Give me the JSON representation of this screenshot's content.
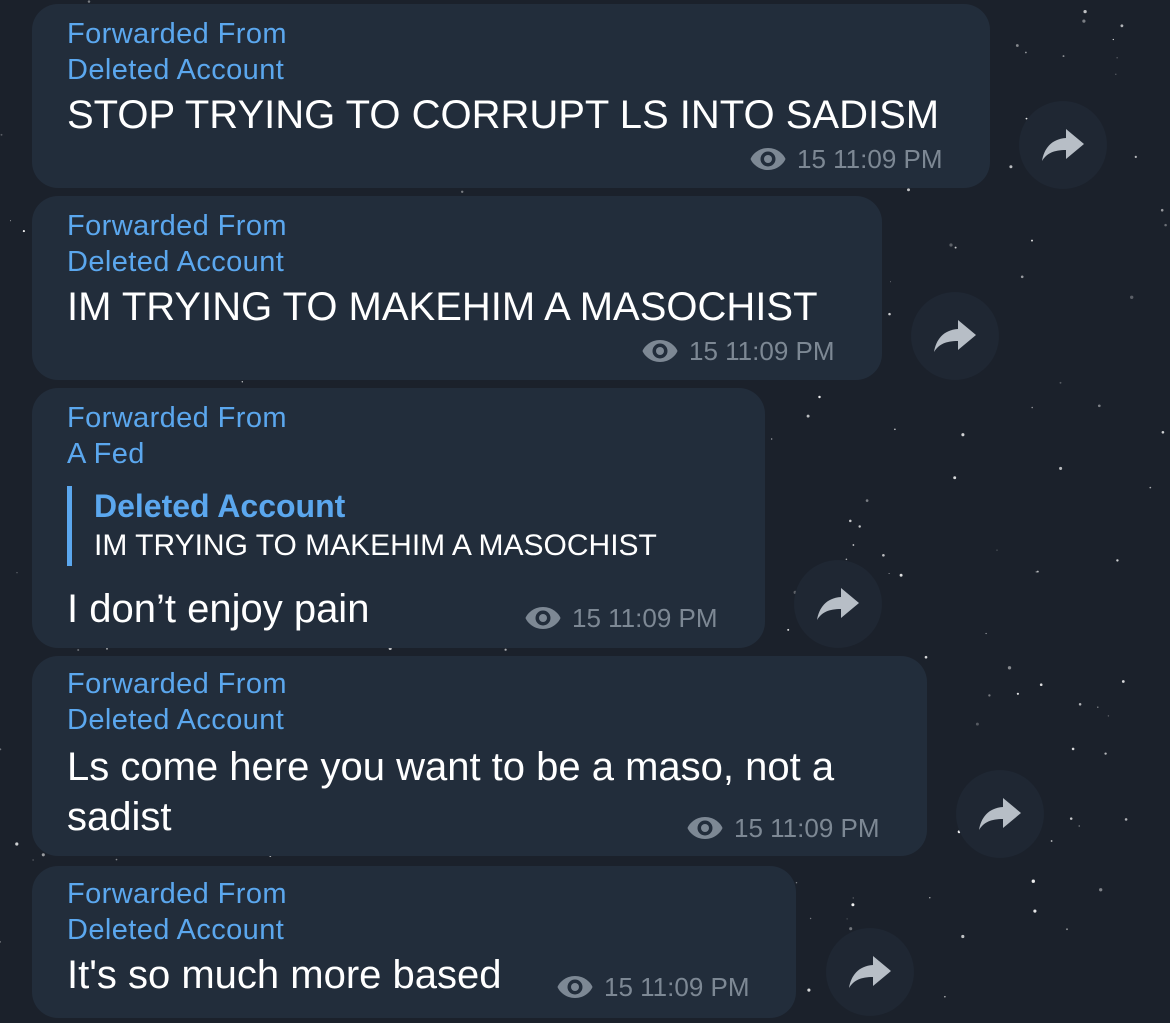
{
  "messages": [
    {
      "forwarded_label": "Forwarded From",
      "forwarded_from": "Deleted Account",
      "text": "STOP TRYING TO CORRUPT LS INTO SADISM",
      "views": "15",
      "time": "11:09 PM"
    },
    {
      "forwarded_label": "Forwarded From",
      "forwarded_from": "Deleted Account",
      "text": "IM TRYING TO MAKEHIM A MASOCHIST",
      "views": "15",
      "time": "11:09 PM"
    },
    {
      "forwarded_label": "Forwarded From",
      "forwarded_from": "A Fed",
      "reply_author": "Deleted Account",
      "reply_text": "IM TRYING TO MAKEHIM A MASOCHIST",
      "text": "I don’t enjoy pain",
      "views": "15",
      "time": "11:09 PM"
    },
    {
      "forwarded_label": "Forwarded From",
      "forwarded_from": "Deleted Account",
      "text_line1": "Ls come here you want to be a maso, not a",
      "text_line2": "sadist",
      "views": "15",
      "time": "11:09 PM"
    },
    {
      "forwarded_label": "Forwarded From",
      "forwarded_from": "Deleted Account",
      "text": "It's so much more based",
      "views": "15",
      "time": "11:09 PM"
    }
  ],
  "icons": {
    "views": "eye-icon",
    "share": "share-arrow-icon"
  },
  "colors": {
    "background": "#1b212b",
    "bubble": "#222d3b",
    "accent": "#5ba7ee",
    "meta": "#7d8894",
    "text": "#ffffff"
  }
}
